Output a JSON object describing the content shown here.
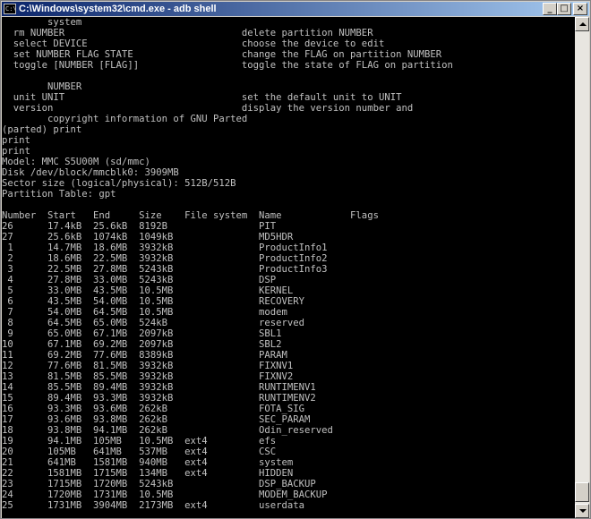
{
  "window": {
    "title": "C:\\Windows\\system32\\cmd.exe - adb  shell",
    "icon_text": "C:\\"
  },
  "title_buttons": {
    "minimize": "_",
    "maximize": "□",
    "close": "×"
  },
  "icons": {
    "app": "cmd-icon",
    "minimize": "minimize-icon",
    "maximize": "maximize-icon",
    "close": "close-icon",
    "scroll_up": "arrow-up-icon",
    "scroll_down": "arrow-down-icon"
  },
  "colors": {
    "console_bg": "#000000",
    "console_fg": "#c0c0c0",
    "titlebar_start": "#0a246a",
    "titlebar_end": "#a6caf0"
  },
  "console": {
    "lines": [
      "        system",
      "  rm NUMBER                               delete partition NUMBER",
      "  select DEVICE                           choose the device to edit",
      "  set NUMBER FLAG STATE                   change the FLAG on partition NUMBER",
      "  toggle [NUMBER [FLAG]]                  toggle the state of FLAG on partition",
      "",
      "        NUMBER",
      "  unit UNIT                               set the default unit to UNIT",
      "  version                                 display the version number and",
      "        copyright information of GNU Parted",
      "(parted) print",
      "print",
      "print",
      "Model: MMC S5U00M (sd/mmc)",
      "Disk /dev/block/mmcblk0: 3909MB",
      "Sector size (logical/physical): 512B/512B",
      "Partition Table: gpt",
      "",
      "Number  Start   End     Size    File system  Name            Flags",
      "26      17.4kB  25.6kB  8192B                PIT",
      "27      25.6kB  1074kB  1049kB               MD5HDR",
      " 1      14.7MB  18.6MB  3932kB               ProductInfo1",
      " 2      18.6MB  22.5MB  3932kB               ProductInfo2",
      " 3      22.5MB  27.8MB  5243kB               ProductInfo3",
      " 4      27.8MB  33.0MB  5243kB               DSP",
      " 5      33.0MB  43.5MB  10.5MB               KERNEL",
      " 6      43.5MB  54.0MB  10.5MB               RECOVERY",
      " 7      54.0MB  64.5MB  10.5MB               modem",
      " 8      64.5MB  65.0MB  524kB                reserved",
      " 9      65.0MB  67.1MB  2097kB               SBL1",
      "10      67.1MB  69.2MB  2097kB               SBL2",
      "11      69.2MB  77.6MB  8389kB               PARAM",
      "12      77.6MB  81.5MB  3932kB               FIXNV1",
      "13      81.5MB  85.5MB  3932kB               FIXNV2",
      "14      85.5MB  89.4MB  3932kB               RUNTIMENV1",
      "15      89.4MB  93.3MB  3932kB               RUNTIMENV2",
      "16      93.3MB  93.6MB  262kB                FOTA_SIG",
      "17      93.6MB  93.8MB  262kB                SEC_PARAM",
      "18      93.8MB  94.1MB  262kB                Odin_reserved",
      "19      94.1MB  105MB   10.5MB  ext4         efs",
      "20      105MB   641MB   537MB   ext4         CSC",
      "21      641MB   1581MB  940MB   ext4         system",
      "22      1581MB  1715MB  134MB   ext4         HIDDEN",
      "23      1715MB  1720MB  5243kB               DSP_BACKUP",
      "24      1720MB  1731MB  10.5MB               MODEM_BACKUP",
      "25      1731MB  3904MB  2173MB  ext4         userdata"
    ]
  }
}
